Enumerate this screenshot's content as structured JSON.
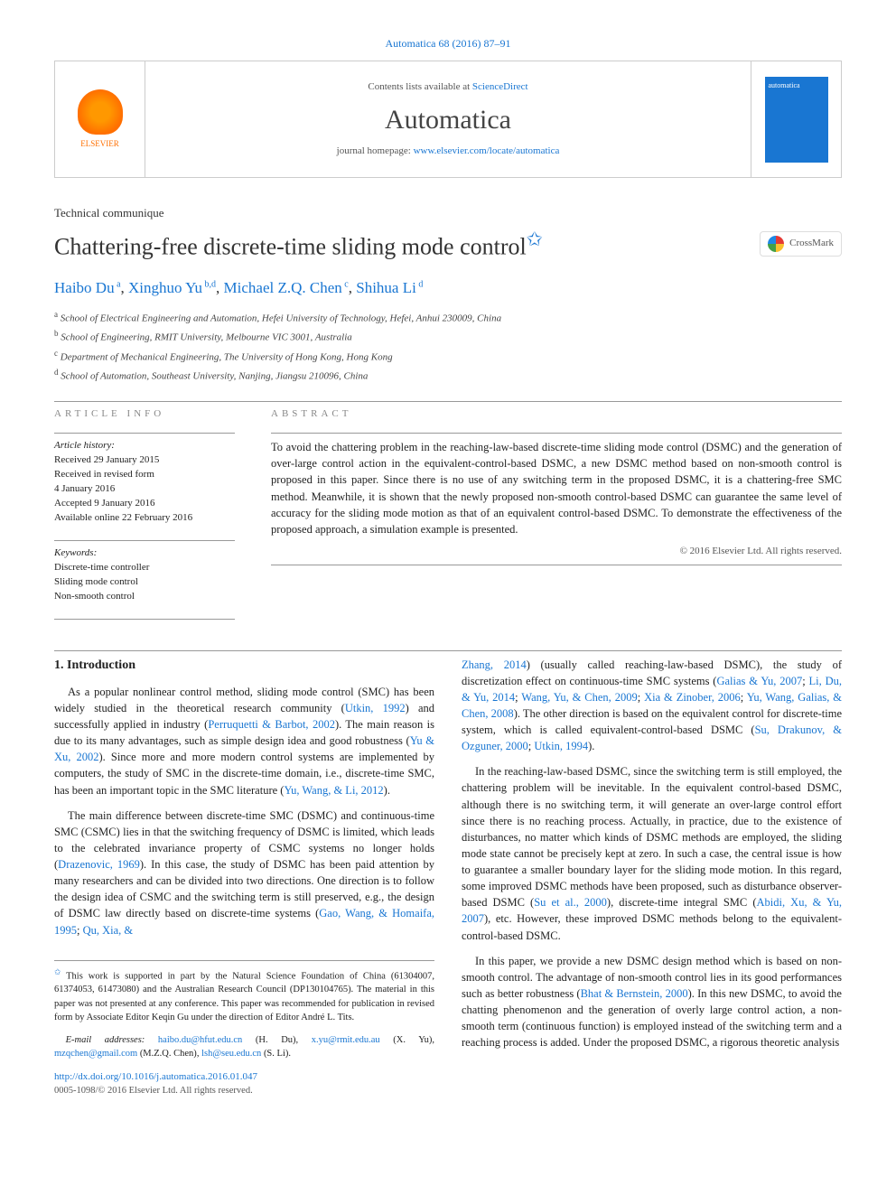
{
  "citation": "Automatica 68 (2016) 87–91",
  "header": {
    "contents_prefix": "Contents lists available at ",
    "contents_link": "ScienceDirect",
    "journal": "Automatica",
    "homepage_prefix": "journal homepage: ",
    "homepage_link": "www.elsevier.com/locate/automatica",
    "publisher_label": "ELSEVIER",
    "cover_label": "automatica"
  },
  "article_type": "Technical communique",
  "title": "Chattering-free discrete-time sliding mode control",
  "title_marker": "✩",
  "crossmark": "CrossMark",
  "authors": [
    {
      "name": "Haibo Du",
      "sup": "a"
    },
    {
      "name": "Xinghuo Yu",
      "sup": "b,d"
    },
    {
      "name": "Michael Z.Q. Chen",
      "sup": "c"
    },
    {
      "name": "Shihua Li",
      "sup": "d"
    }
  ],
  "affiliations": [
    {
      "sup": "a",
      "text": "School of Electrical Engineering and Automation, Hefei University of Technology, Hefei, Anhui 230009, China"
    },
    {
      "sup": "b",
      "text": "School of Engineering, RMIT University, Melbourne VIC 3001, Australia"
    },
    {
      "sup": "c",
      "text": "Department of Mechanical Engineering, The University of Hong Kong, Hong Kong"
    },
    {
      "sup": "d",
      "text": "School of Automation, Southeast University, Nanjing, Jiangsu 210096, China"
    }
  ],
  "info": {
    "label": "ARTICLE INFO",
    "history_label": "Article history:",
    "history": [
      "Received 29 January 2015",
      "Received in revised form",
      "4 January 2016",
      "Accepted 9 January 2016",
      "Available online 22 February 2016"
    ],
    "keywords_label": "Keywords:",
    "keywords": [
      "Discrete-time controller",
      "Sliding mode control",
      "Non-smooth control"
    ]
  },
  "abstract": {
    "label": "ABSTRACT",
    "text": "To avoid the chattering problem in the reaching-law-based discrete-time sliding mode control (DSMC) and the generation of over-large control action in the equivalent-control-based DSMC, a new DSMC method based on non-smooth control is proposed in this paper. Since there is no use of any switching term in the proposed DSMC, it is a chattering-free SMC method. Meanwhile, it is shown that the newly proposed non-smooth control-based DSMC can guarantee the same level of accuracy for the sliding mode motion as that of an equivalent control-based DSMC. To demonstrate the effectiveness of the proposed approach, a simulation example is presented.",
    "copyright": "© 2016 Elsevier Ltd. All rights reserved."
  },
  "body": {
    "heading": "1. Introduction",
    "left": [
      {
        "type": "p",
        "runs": [
          {
            "t": "As a popular nonlinear control method, sliding mode control (SMC) has been widely studied in the theoretical research community ("
          },
          {
            "t": "Utkin, 1992",
            "ref": true
          },
          {
            "t": ") and successfully applied in industry ("
          },
          {
            "t": "Perruquetti & Barbot, 2002",
            "ref": true
          },
          {
            "t": "). The main reason is due to its many advantages, such as simple design idea and good robustness ("
          },
          {
            "t": "Yu & Xu, 2002",
            "ref": true
          },
          {
            "t": "). Since more and more modern control systems are implemented by computers, the study of SMC in the discrete-time domain, i.e., discrete-time SMC, has been an important topic in the SMC literature ("
          },
          {
            "t": "Yu, Wang, & Li, 2012",
            "ref": true
          },
          {
            "t": ")."
          }
        ]
      },
      {
        "type": "p",
        "runs": [
          {
            "t": "The main difference between discrete-time SMC (DSMC) and continuous-time SMC (CSMC) lies in that the switching frequency of DSMC is limited, which leads to the celebrated invariance property of CSMC systems no longer holds ("
          },
          {
            "t": "Drazenovic, 1969",
            "ref": true
          },
          {
            "t": "). In this case, the study of DSMC has been paid attention by many researchers and can be divided into two directions. One direction is to follow the design idea of CSMC and the switching term is still preserved, e.g., the design of DSMC law directly based on discrete-time systems ("
          },
          {
            "t": "Gao, Wang, & Homaifa, 1995",
            "ref": true
          },
          {
            "t": "; "
          },
          {
            "t": "Qu, Xia, &",
            "ref": true
          }
        ]
      }
    ],
    "right": [
      {
        "type": "p",
        "noindent": true,
        "runs": [
          {
            "t": "Zhang, 2014",
            "ref": true
          },
          {
            "t": ") (usually called reaching-law-based DSMC), the study of discretization effect on continuous-time SMC systems ("
          },
          {
            "t": "Galias & Yu, 2007",
            "ref": true
          },
          {
            "t": "; "
          },
          {
            "t": "Li, Du, & Yu, 2014",
            "ref": true
          },
          {
            "t": "; "
          },
          {
            "t": "Wang, Yu, & Chen, 2009",
            "ref": true
          },
          {
            "t": "; "
          },
          {
            "t": "Xia & Zinober, 2006",
            "ref": true
          },
          {
            "t": "; "
          },
          {
            "t": "Yu, Wang, Galias, & Chen, 2008",
            "ref": true
          },
          {
            "t": "). The other direction is based on the equivalent control for discrete-time system, which is called equivalent-control-based DSMC ("
          },
          {
            "t": "Su, Drakunov, & Ozguner, 2000",
            "ref": true
          },
          {
            "t": "; "
          },
          {
            "t": "Utkin, 1994",
            "ref": true
          },
          {
            "t": ")."
          }
        ]
      },
      {
        "type": "p",
        "runs": [
          {
            "t": "In the reaching-law-based DSMC, since the switching term is still employed, the chattering problem will be inevitable. In the equivalent control-based DSMC, although there is no switching term, it will generate an over-large control effort since there is no reaching process. Actually, in practice, due to the existence of disturbances, no matter which kinds of DSMC methods are employed, the sliding mode state cannot be precisely kept at zero. In such a case, the central issue is how to guarantee a smaller boundary layer for the sliding mode motion. In this regard, some improved DSMC methods have been proposed, such as disturbance observer-based DSMC ("
          },
          {
            "t": "Su et al., 2000",
            "ref": true
          },
          {
            "t": "), discrete-time integral SMC ("
          },
          {
            "t": "Abidi, Xu, & Yu, 2007",
            "ref": true
          },
          {
            "t": "), etc. However, these improved DSMC methods belong to the equivalent-control-based DSMC."
          }
        ]
      },
      {
        "type": "p",
        "runs": [
          {
            "t": "In this paper, we provide a new DSMC design method which is based on non-smooth control. The advantage of non-smooth control lies in its good performances such as better robustness ("
          },
          {
            "t": "Bhat & Bernstein, 2000",
            "ref": true
          },
          {
            "t": "). In this new DSMC, to avoid the chatting phenomenon and the generation of overly large control action, a non-smooth term (continuous function) is employed instead of the switching term and a reaching process is added. Under the proposed DSMC, a rigorous theoretic analysis"
          }
        ]
      }
    ]
  },
  "footnotes": {
    "funding_marker": "✩",
    "funding": "This work is supported in part by the Natural Science Foundation of China (61304007, 61374053, 61473080) and the Australian Research Council (DP130104765). The material in this paper was not presented at any conference. This paper was recommended for publication in revised form by Associate Editor Keqin Gu under the direction of Editor André L. Tits.",
    "email_label": "E-mail addresses:",
    "emails": [
      {
        "addr": "haibo.du@hfut.edu.cn",
        "who": "(H. Du)"
      },
      {
        "addr": "x.yu@rmit.edu.au",
        "who": "(X. Yu)"
      },
      {
        "addr": "mzqchen@gmail.com",
        "who": "(M.Z.Q. Chen)"
      },
      {
        "addr": "lsh@seu.edu.cn",
        "who": "(S. Li)"
      }
    ]
  },
  "doi": "http://dx.doi.org/10.1016/j.automatica.2016.01.047",
  "issn": "0005-1098/© 2016 Elsevier Ltd. All rights reserved."
}
